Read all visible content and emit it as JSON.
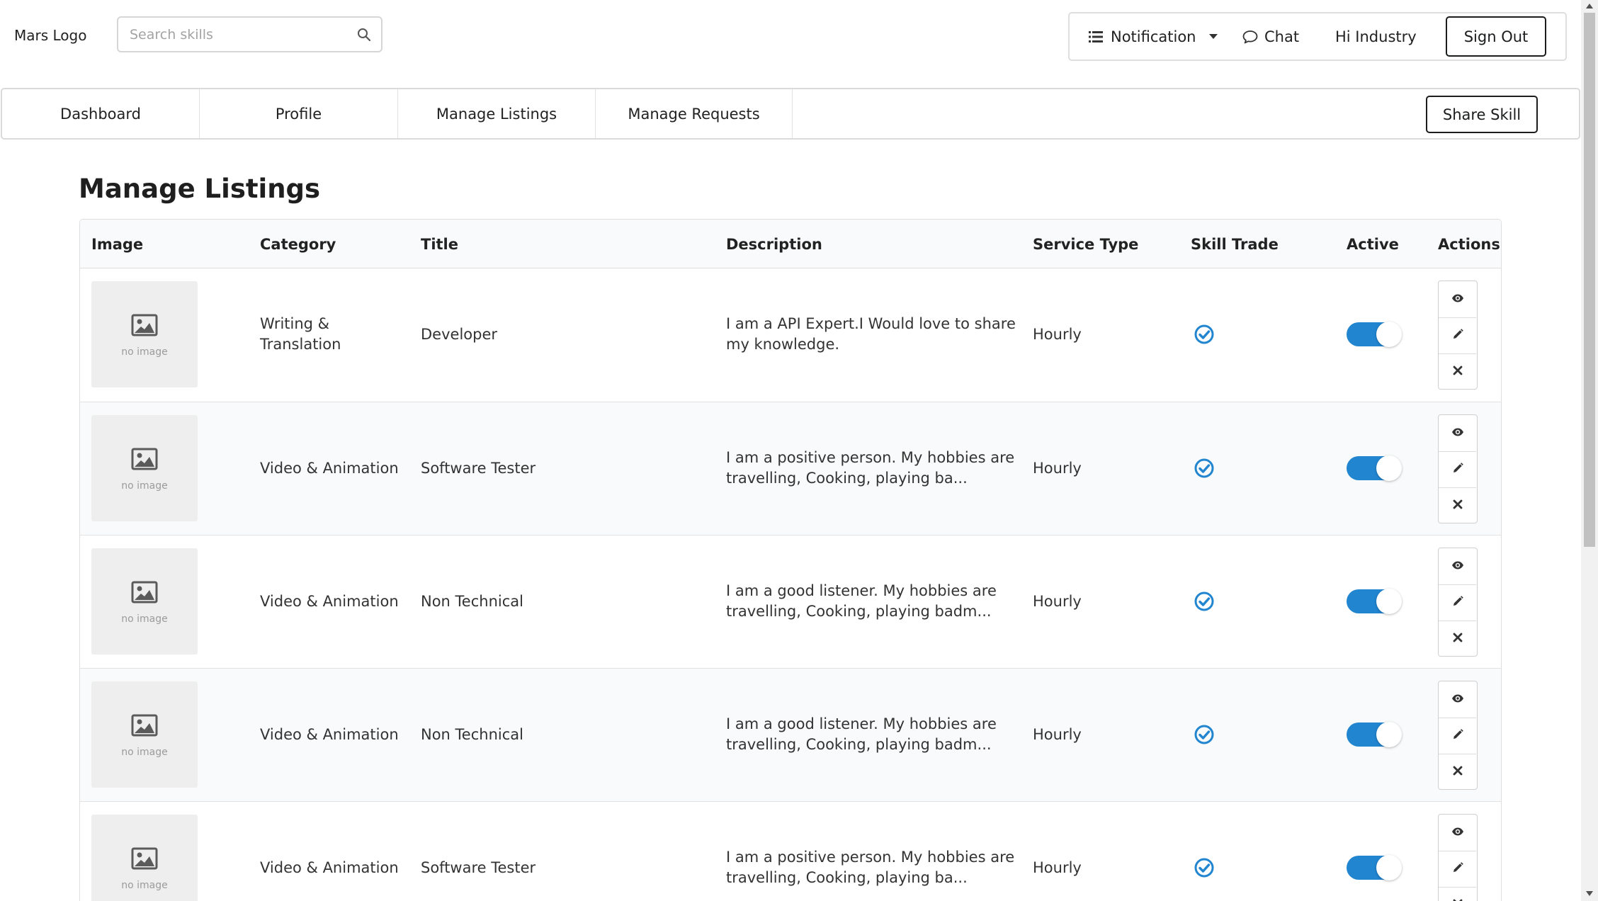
{
  "header": {
    "logo": "Mars Logo",
    "search_placeholder": "Search skills",
    "search_icon": "search-icon",
    "notification_label": "Notification",
    "notification_icon": "list-icon",
    "chat_label": "Chat",
    "chat_icon": "chat-bubble-icon",
    "greeting": "Hi Industry",
    "signout_label": "Sign Out"
  },
  "nav": {
    "tabs": [
      {
        "label": "Dashboard"
      },
      {
        "label": "Profile"
      },
      {
        "label": "Manage Listings"
      },
      {
        "label": "Manage Requests"
      }
    ],
    "share_label": "Share Skill"
  },
  "page": {
    "title": "Manage Listings"
  },
  "table": {
    "columns": [
      "Image",
      "Category",
      "Title",
      "Description",
      "Service Type",
      "Skill Trade",
      "Active",
      "Actions"
    ],
    "no_image_text": "no image",
    "rows": [
      {
        "category": "Writing & Translation",
        "title": "Developer",
        "description": "I am a API Expert.I Would love to share my knowledge.",
        "service_type": "Hourly",
        "skill_trade": true,
        "active": true
      },
      {
        "category": "Video & Animation",
        "title": "Software Tester",
        "description": "I am a positive person. My hobbies are travelling, Cooking, playing ba...",
        "service_type": "Hourly",
        "skill_trade": true,
        "active": true
      },
      {
        "category": "Video & Animation",
        "title": "Non Technical",
        "description": "I am a good listener. My hobbies are travelling, Cooking, playing badm...",
        "service_type": "Hourly",
        "skill_trade": true,
        "active": true
      },
      {
        "category": "Video & Animation",
        "title": "Non Technical",
        "description": "I am a good listener. My hobbies are travelling, Cooking, playing badm...",
        "service_type": "Hourly",
        "skill_trade": true,
        "active": true
      },
      {
        "category": "Video & Animation",
        "title": "Software Tester",
        "description": "I am a positive person. My hobbies are travelling, Cooking, playing ba...",
        "service_type": "Hourly",
        "skill_trade": true,
        "active": true
      }
    ],
    "action_icons": [
      "eye-icon",
      "pencil-icon",
      "close-icon"
    ]
  },
  "colors": {
    "accent": "#2185d0",
    "header_bg": "#f9fafb",
    "stripe_bg": "#f9fafb",
    "border": "#dedede"
  }
}
